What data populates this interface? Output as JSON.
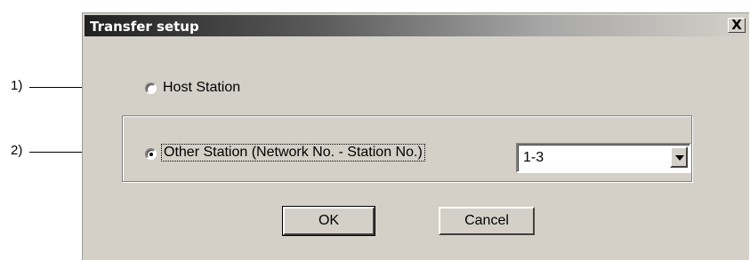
{
  "window": {
    "title": "Transfer setup",
    "close_label": "X"
  },
  "callouts": {
    "c1": "1)",
    "c2": "2)"
  },
  "options": {
    "host_station": {
      "label": "Host Station",
      "selected": false
    },
    "other_station": {
      "label": "Other Station (Network No. - Station No.)",
      "selected": true
    }
  },
  "station_select": {
    "value": "1-3"
  },
  "buttons": {
    "ok": "OK",
    "cancel": "Cancel"
  }
}
